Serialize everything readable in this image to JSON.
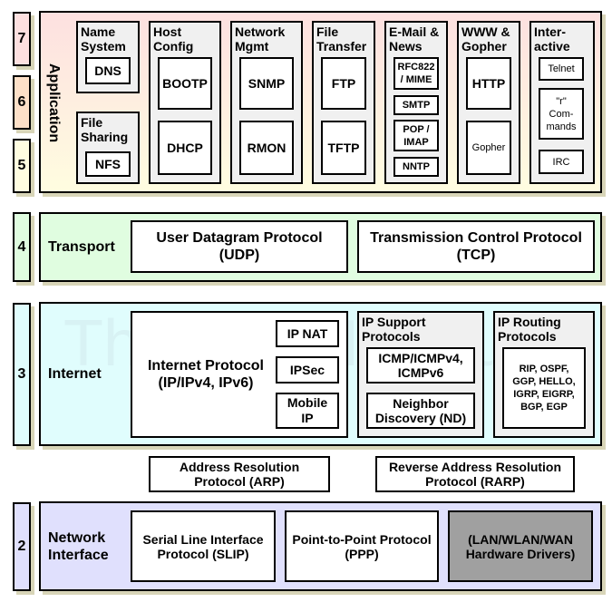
{
  "colors": {
    "application_top": "#fde0e0",
    "application_bottom": "#fffde0",
    "transport": "#e0fde0",
    "internet": "#e0fdfd",
    "network_interface": "#e0e0fd",
    "group_bg": "#f0f0f0",
    "hardware_drivers": "#a0a0a0"
  },
  "layer_numbers": {
    "l7": "7",
    "l6": "6",
    "l5": "5",
    "l4": "4",
    "l3": "3",
    "l2": "2"
  },
  "watermark": "The TCP/IP Guide",
  "application": {
    "label": "Application",
    "groups": {
      "name_system": {
        "title": "Name\nSystem",
        "items": [
          "DNS"
        ]
      },
      "file_sharing": {
        "title": "File\nSharing",
        "items": [
          "NFS"
        ]
      },
      "host_config": {
        "title": "Host\nConfig",
        "items": [
          "BOOTP",
          "DHCP"
        ]
      },
      "network_mgmt": {
        "title": "Network\nMgmt",
        "items": [
          "SNMP",
          "RMON"
        ]
      },
      "file_transfer": {
        "title": "File\nTransfer",
        "items": [
          "FTP",
          "TFTP"
        ]
      },
      "email_news": {
        "title": "E-Mail &\nNews",
        "items": [
          "RFC822\n/ MIME",
          "SMTP",
          "POP /\nIMAP",
          "NNTP"
        ]
      },
      "www_gopher": {
        "title": "WWW &\nGopher",
        "items": [
          "HTTP",
          "Gopher"
        ]
      },
      "interactive": {
        "title": "Inter-\nactive",
        "items": [
          "Telnet",
          "\"r\"\nCom-\nmands",
          "IRC"
        ]
      }
    }
  },
  "transport": {
    "label": "Transport",
    "udp": "User Datagram Protocol\n(UDP)",
    "tcp": "Transmission Control Protocol\n(TCP)"
  },
  "internet": {
    "label": "Internet",
    "ip": "Internet Protocol\n(IP/IPv4, IPv6)",
    "ip_items": [
      "IP NAT",
      "IPSec",
      "Mobile\nIP"
    ],
    "support": {
      "title": "IP Support\nProtocols",
      "items": [
        "ICMP/ICMPv4,\nICMPv6",
        "Neighbor\nDiscovery (ND)"
      ]
    },
    "routing": {
      "title": "IP Routing\nProtocols",
      "items": [
        "RIP, OSPF,\nGGP, HELLO,\nIGRP, EIGRP,\nBGP, EGP"
      ]
    }
  },
  "between": {
    "arp": "Address Resolution\nProtocol (ARP)",
    "rarp": "Reverse Address Resolution\nProtocol (RARP)"
  },
  "network_interface": {
    "label": "Network\nInterface",
    "slip": "Serial Line Interface\nProtocol (SLIP)",
    "ppp": "Point-to-Point Protocol\n(PPP)",
    "drivers": "(LAN/WLAN/WAN\nHardware Drivers)"
  }
}
